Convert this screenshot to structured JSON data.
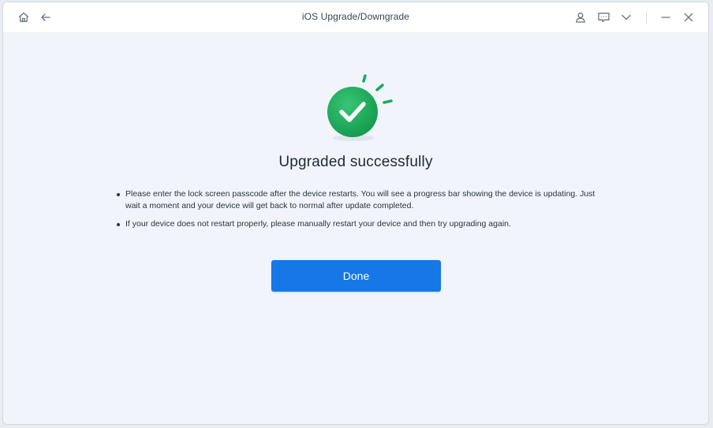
{
  "window": {
    "title": "iOS Upgrade/Downgrade"
  },
  "toolbar": {
    "left_icons": [
      "home-icon",
      "back-arrow-icon"
    ],
    "right_icons": [
      "user-icon",
      "feedback-icon",
      "chevron-down-icon",
      "minimize-icon",
      "close-icon"
    ]
  },
  "result": {
    "icon": "check-circle-icon",
    "heading": "Upgraded successfully",
    "notes": [
      "Please enter the lock screen passcode after the device restarts. You will see a progress bar showing the device is updating. Just wait a moment and your device will get back to normal after update completed.",
      "If your device does not restart properly, please manually restart your device and then try upgrading again."
    ]
  },
  "actions": {
    "done_label": "Done"
  },
  "colors": {
    "accent_blue": "#1677e6",
    "success_green": "#18a957",
    "background": "#f1f5fb"
  }
}
